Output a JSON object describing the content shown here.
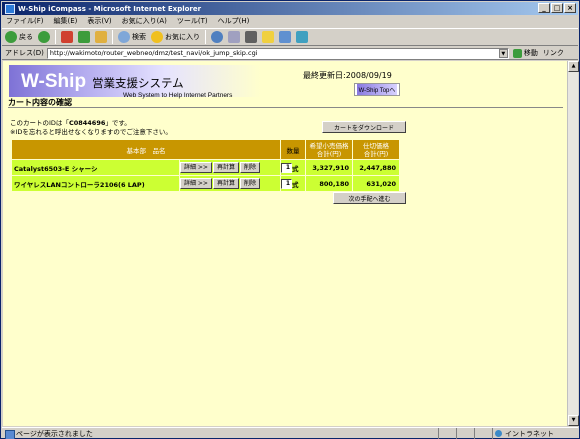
{
  "window": {
    "title": "W-Ship iCompass - Microsoft Internet Explorer",
    "min": "_",
    "max": "□",
    "close": "×"
  },
  "menu": [
    "ファイル(F)",
    "編集(E)",
    "表示(V)",
    "お気に入り(A)",
    "ツール(T)",
    "ヘルプ(H)"
  ],
  "toolbar": {
    "back": "戻る",
    "search": "検索",
    "favorites": "お気に入り"
  },
  "address": {
    "label": "アドレス(D)",
    "url": "http://wakimoto/router_webneo/dmz/test_navi/ok_jump_skip.cgi",
    "go": "移動",
    "links": "リンク"
  },
  "header": {
    "logo_main": "W-Ship",
    "logo_ja": "営業支援システム",
    "logo_en": "Web System to Help Internet Partners",
    "updated": "最終更新日:2008/09/19",
    "top_button": "W-Ship Topへ",
    "page_title": "カート内容の確認"
  },
  "message": {
    "prefix": "このカートのIDは「",
    "cart_id": "C0844696",
    "suffix": "」です。",
    "line2": "※IDを忘れると呼出せなくなりますのでご注意下さい。"
  },
  "buttons": {
    "download": "カートをダウンロード",
    "next": "次の手配へ進む"
  },
  "table": {
    "headers": {
      "name": "基本部　品名",
      "qty": "数量",
      "list_price": "希望小売価格\n合計(円)",
      "cost": "仕切価格\n合計(円)"
    },
    "row_buttons": {
      "detail": "詳細 >>",
      "recalc": "再計算",
      "delete": "削除"
    },
    "unit": "式",
    "rows": [
      {
        "name": "Catalyst6503-E シャーシ",
        "qty": "1",
        "list_price": "3,327,910",
        "cost": "2,447,880"
      },
      {
        "name": "ワイヤレスLANコントローラ2106(6 LAP)",
        "qty": "1",
        "list_price": "800,180",
        "cost": "631,020"
      }
    ]
  },
  "status": {
    "text": "ページが表示されました",
    "zone": "イントラネット"
  }
}
